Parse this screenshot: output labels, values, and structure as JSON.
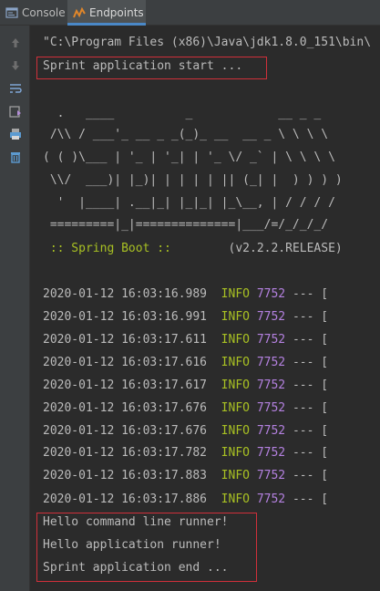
{
  "tabs": {
    "console": "Console",
    "endpoints": "Endpoints"
  },
  "command": "\"C:\\Program Files (x86)\\Java\\jdk1.8.0_151\\bin\\",
  "start_msg": "Sprint application start ...",
  "banner": [
    "  .   ____          _            __ _ _",
    " /\\\\ / ___'_ __ _ _(_)_ __  __ _ \\ \\ \\ \\",
    "( ( )\\___ | '_ | '_| | '_ \\/ _` | \\ \\ \\ \\",
    " \\\\/  ___)| |_)| | | | | || (_| |  ) ) ) )",
    "  '  |____| .__|_| |_|_| |_\\__, | / / / /",
    " =========|_|==============|___/=/_/_/_/"
  ],
  "spring_boot_label": " :: Spring Boot ::",
  "spring_boot_version": "(v2.2.2.RELEASE)",
  "log_lines": [
    {
      "ts": "2020-01-12 16:03:16.989",
      "level": "INFO",
      "pid": "7752",
      "rest": "--- ["
    },
    {
      "ts": "2020-01-12 16:03:16.991",
      "level": "INFO",
      "pid": "7752",
      "rest": "--- ["
    },
    {
      "ts": "2020-01-12 16:03:17.611",
      "level": "INFO",
      "pid": "7752",
      "rest": "--- ["
    },
    {
      "ts": "2020-01-12 16:03:17.616",
      "level": "INFO",
      "pid": "7752",
      "rest": "--- ["
    },
    {
      "ts": "2020-01-12 16:03:17.617",
      "level": "INFO",
      "pid": "7752",
      "rest": "--- ["
    },
    {
      "ts": "2020-01-12 16:03:17.676",
      "level": "INFO",
      "pid": "7752",
      "rest": "--- ["
    },
    {
      "ts": "2020-01-12 16:03:17.676",
      "level": "INFO",
      "pid": "7752",
      "rest": "--- ["
    },
    {
      "ts": "2020-01-12 16:03:17.782",
      "level": "INFO",
      "pid": "7752",
      "rest": "--- ["
    },
    {
      "ts": "2020-01-12 16:03:17.883",
      "level": "INFO",
      "pid": "7752",
      "rest": "--- ["
    },
    {
      "ts": "2020-01-12 16:03:17.886",
      "level": "INFO",
      "pid": "7752",
      "rest": "--- ["
    }
  ],
  "runner_msgs": [
    "Hello command line runner!",
    "Hello application runner!",
    "Sprint application end ..."
  ],
  "colors": {
    "accent": "#4a88c7",
    "highlight_box": "#d0303a",
    "info": "#a8c023",
    "pid": "#b481e0"
  },
  "gutter_icons": [
    "up-arrow-icon",
    "down-arrow-icon",
    "soft-wrap-icon",
    "scroll-to-end-icon",
    "print-icon",
    "trash-icon"
  ]
}
